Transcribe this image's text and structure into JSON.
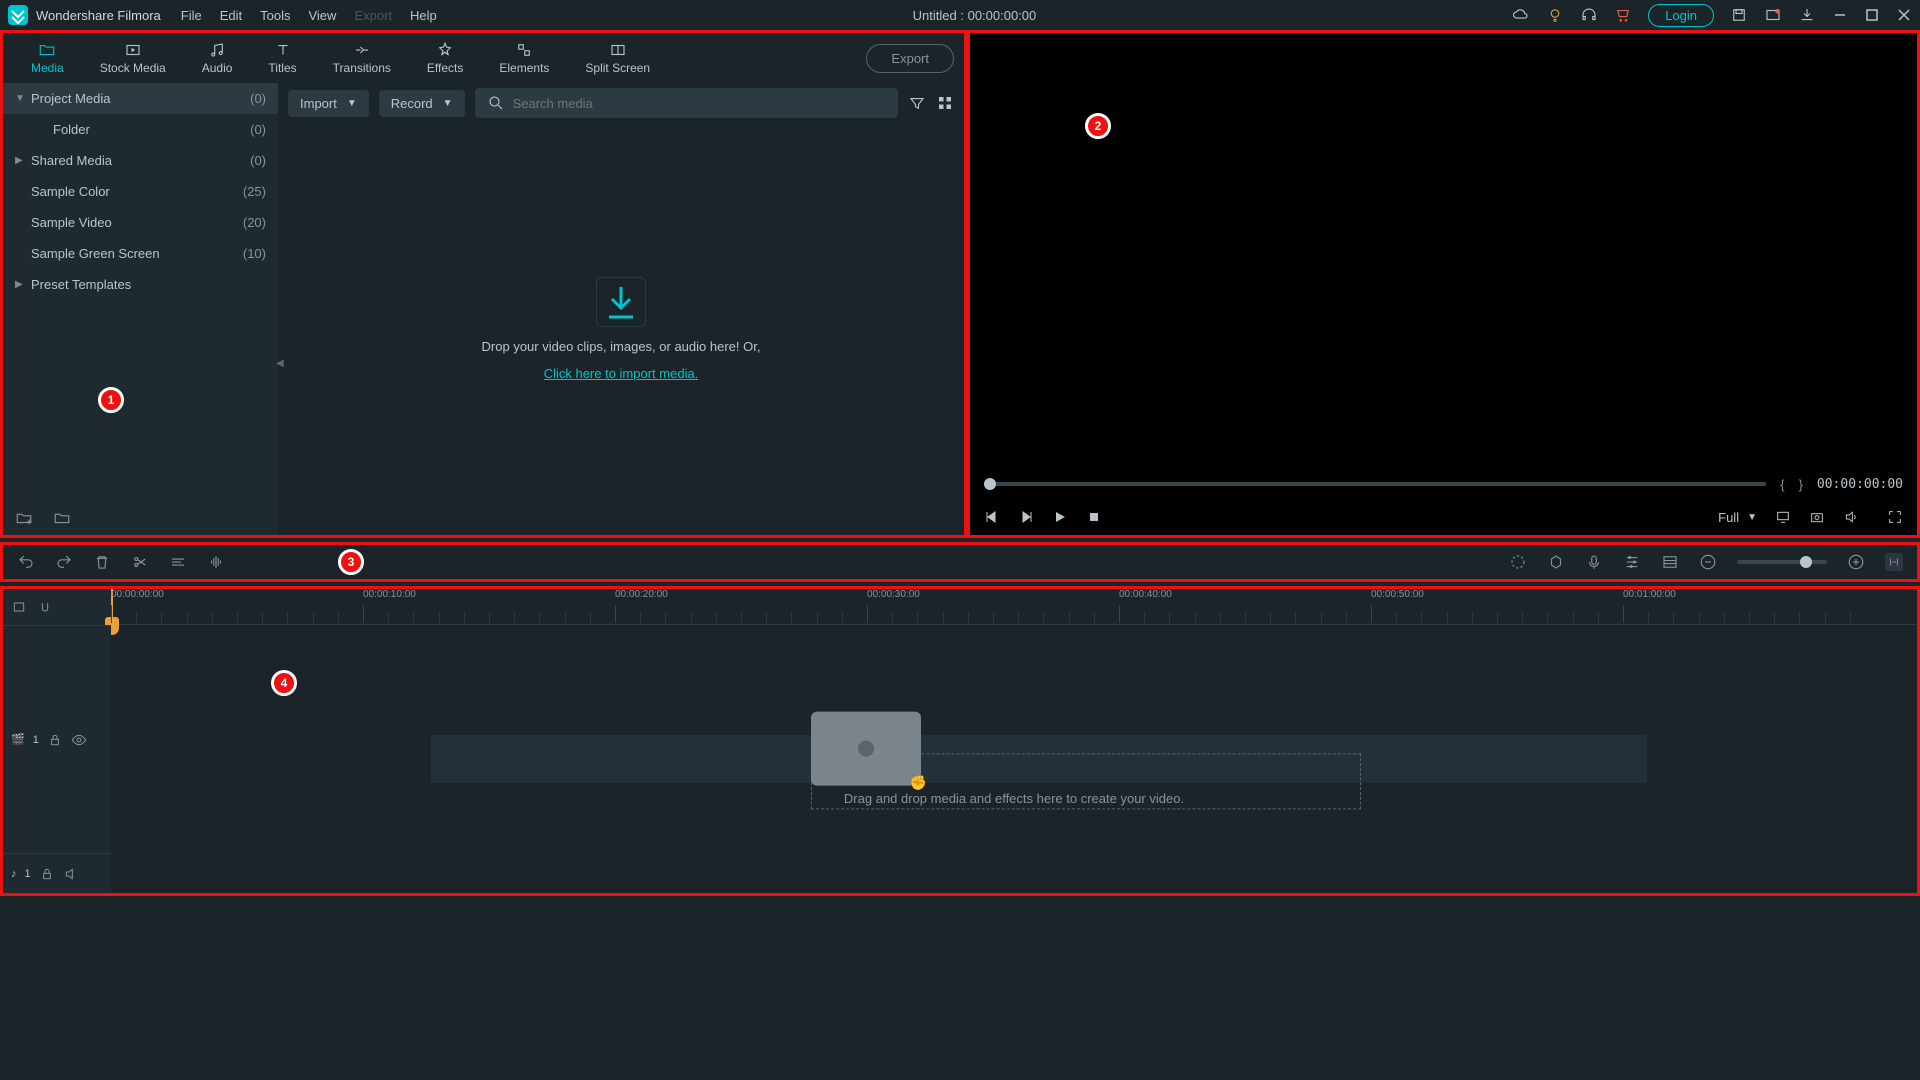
{
  "app": {
    "name": "Wondershare Filmora"
  },
  "menubar": [
    "File",
    "Edit",
    "Tools",
    "View",
    "Export",
    "Help"
  ],
  "title": "Untitled : 00:00:00:00",
  "login": "Login",
  "tabs": [
    {
      "label": "Media",
      "icon": "folder"
    },
    {
      "label": "Stock Media",
      "icon": "video"
    },
    {
      "label": "Audio",
      "icon": "music"
    },
    {
      "label": "Titles",
      "icon": "text"
    },
    {
      "label": "Transitions",
      "icon": "transition"
    },
    {
      "label": "Effects",
      "icon": "effects"
    },
    {
      "label": "Elements",
      "icon": "elements"
    },
    {
      "label": "Split Screen",
      "icon": "split"
    }
  ],
  "export_btn": "Export",
  "tree": {
    "project_media": {
      "label": "Project Media",
      "count": "(0)"
    },
    "folder": {
      "label": "Folder",
      "count": "(0)"
    },
    "shared_media": {
      "label": "Shared Media",
      "count": "(0)"
    },
    "sample_color": {
      "label": "Sample Color",
      "count": "(25)"
    },
    "sample_video": {
      "label": "Sample Video",
      "count": "(20)"
    },
    "sample_green": {
      "label": "Sample Green Screen",
      "count": "(10)"
    },
    "preset": {
      "label": "Preset Templates",
      "count": ""
    }
  },
  "media_toolbar": {
    "import": "Import",
    "record": "Record",
    "search_placeholder": "Search media"
  },
  "drop": {
    "text": "Drop your video clips, images, or audio here! Or,",
    "link": "Click here to import media."
  },
  "preview": {
    "timecode": "00:00:00:00",
    "quality": "Full"
  },
  "timeline": {
    "ticks": [
      "00:00:00:00",
      "00:00:10:00",
      "00:00:20:00",
      "00:00:30:00",
      "00:00:40:00",
      "00:00:50:00",
      "00:01:00:00"
    ],
    "hint": "Drag and drop media and effects here to create your video."
  },
  "track_labels": {
    "video": "1",
    "audio": "1"
  },
  "badges": [
    "1",
    "2",
    "3",
    "4"
  ]
}
